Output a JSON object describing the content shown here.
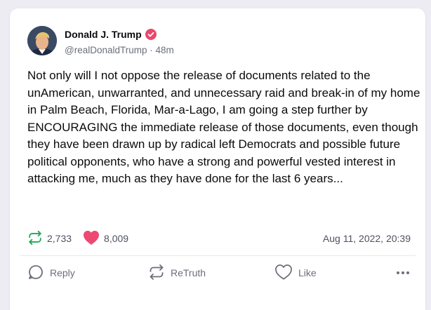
{
  "post": {
    "author_name": "Donald J. Trump",
    "handle": "@realDonaldTrump",
    "separator": " · ",
    "time_ago": "48m",
    "text": "Not only will I not oppose the release of documents related to the unAmerican, unwarranted, and unnecessary raid and break-in of my home in Palm Beach, Florida, Mar-a-Lago, I am going a step further by ENCOURAGING the immediate release of those documents, even though they have been drawn up by radical left Democrats and possible future political opponents, who have a strong and powerful vested interest in attacking me, much as they have done for the last 6 years...",
    "retruth_count": "2,733",
    "like_count": "8,009",
    "timestamp": "Aug 11, 2022, 20:39"
  },
  "actions": {
    "reply_label": "Reply",
    "retruth_label": "ReTruth",
    "like_label": "Like"
  },
  "icons": {
    "verified": "verified-badge-icon",
    "retruth": "retruth-icon",
    "like": "heart-icon",
    "reply": "reply-icon",
    "more": "more-icon"
  },
  "colors": {
    "verified": "#e8486c",
    "retruth_green": "#1fa855",
    "like_pink": "#ec4a73",
    "text": "#0b0b0f",
    "muted": "#6b6f7b",
    "background": "#ececf2",
    "card": "#ffffff"
  }
}
